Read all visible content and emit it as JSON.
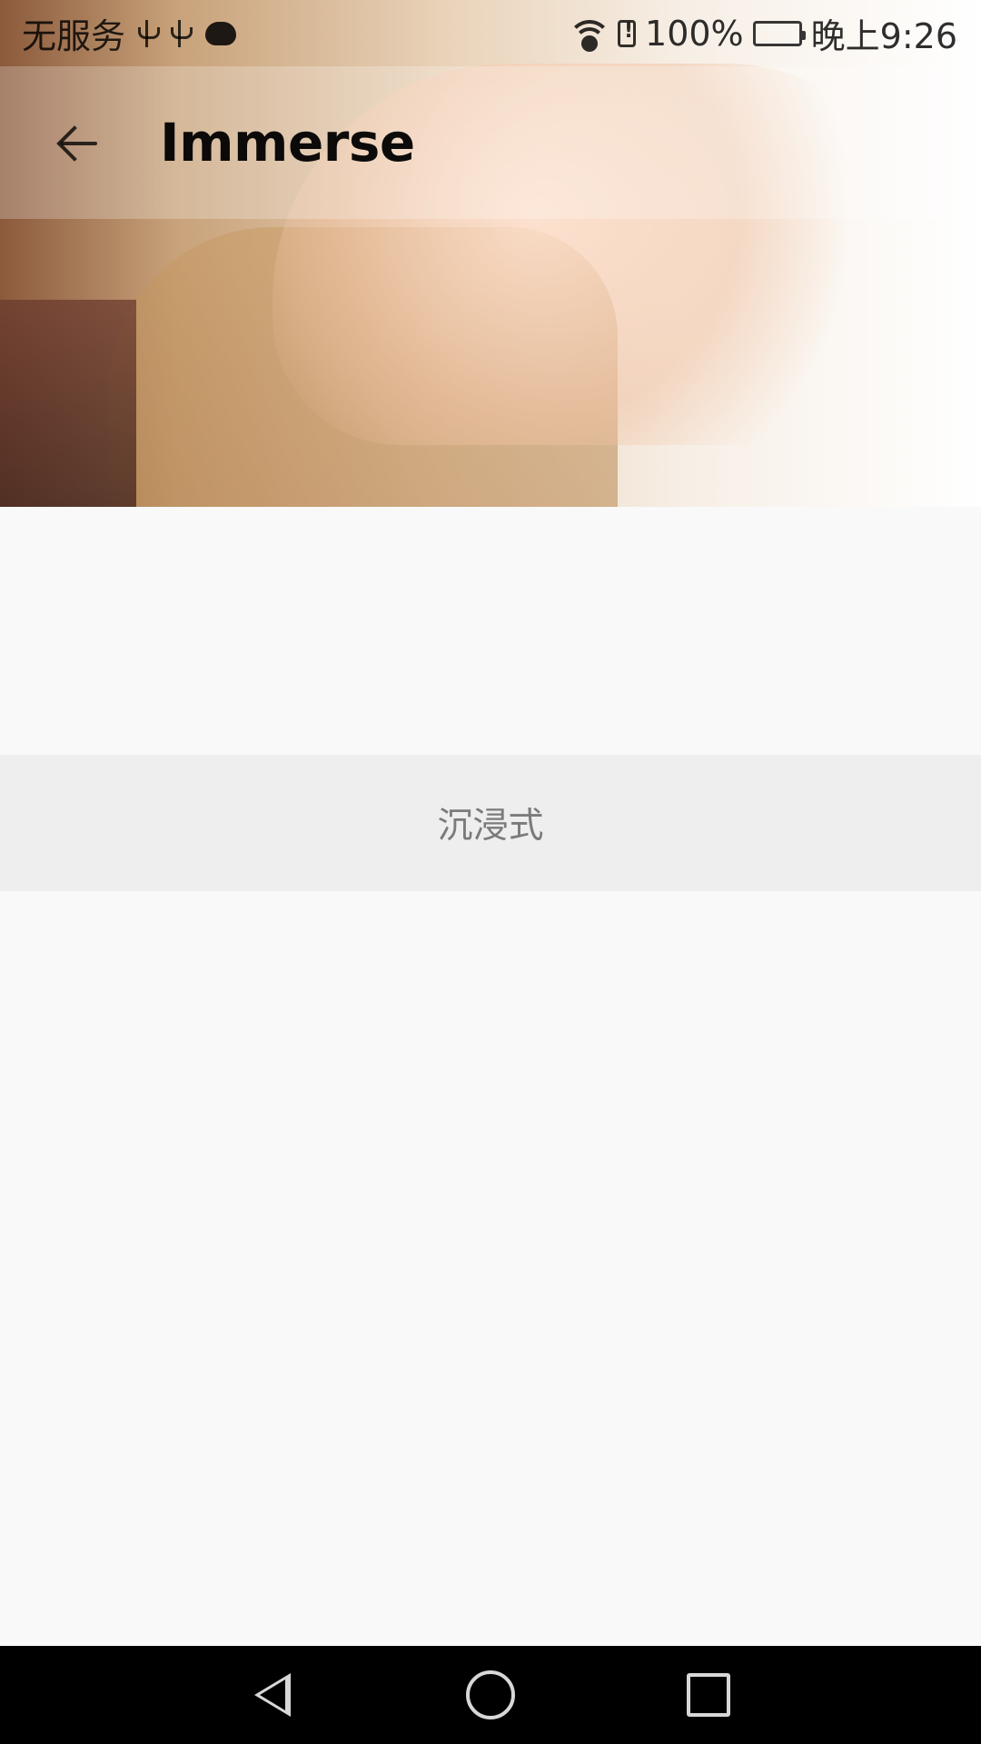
{
  "status_bar": {
    "carrier": "无服务",
    "battery_percent": "100%",
    "time": "晚上9:26",
    "icons": [
      "usb-icon",
      "usb-icon",
      "cloud-icon",
      "wifi-icon",
      "sim-alert-icon",
      "battery-icon"
    ],
    "battery_color": "#19c44b"
  },
  "app_bar": {
    "title": "Immerse",
    "back_icon": "arrow-left-icon"
  },
  "content": {
    "panel_text": "沉浸式"
  },
  "navigation_bar": {
    "buttons": [
      "back",
      "home",
      "recents"
    ]
  }
}
